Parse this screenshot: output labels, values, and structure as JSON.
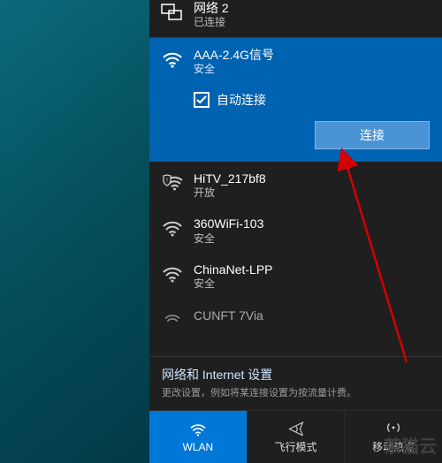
{
  "networks": {
    "top_connected": {
      "name": "网络 2",
      "status": "已连接"
    },
    "selected": {
      "name": "AAA-2.4G信号",
      "status": "安全",
      "auto_connect_label": "自动连接",
      "auto_connect_checked": true,
      "connect_button": "连接"
    },
    "list": [
      {
        "name": "HiTV_217bf8",
        "status": "开放",
        "icon": "wifi-shield"
      },
      {
        "name": "360WiFi-103",
        "status": "安全",
        "icon": "wifi-secure"
      },
      {
        "name": "ChinaNet-LPP",
        "status": "安全",
        "icon": "wifi-secure"
      },
      {
        "name": "CUNFT 7Via",
        "status": "",
        "icon": "wifi"
      }
    ]
  },
  "settings": {
    "title": "网络和 Internet 设置",
    "subtitle": "更改设置，例如将某连接设置为按流量计费。"
  },
  "bottom_bar": {
    "wlan": "WLAN",
    "airplane": "飞行模式",
    "hotspot": "移动热点"
  },
  "watermark": "茶猫云"
}
